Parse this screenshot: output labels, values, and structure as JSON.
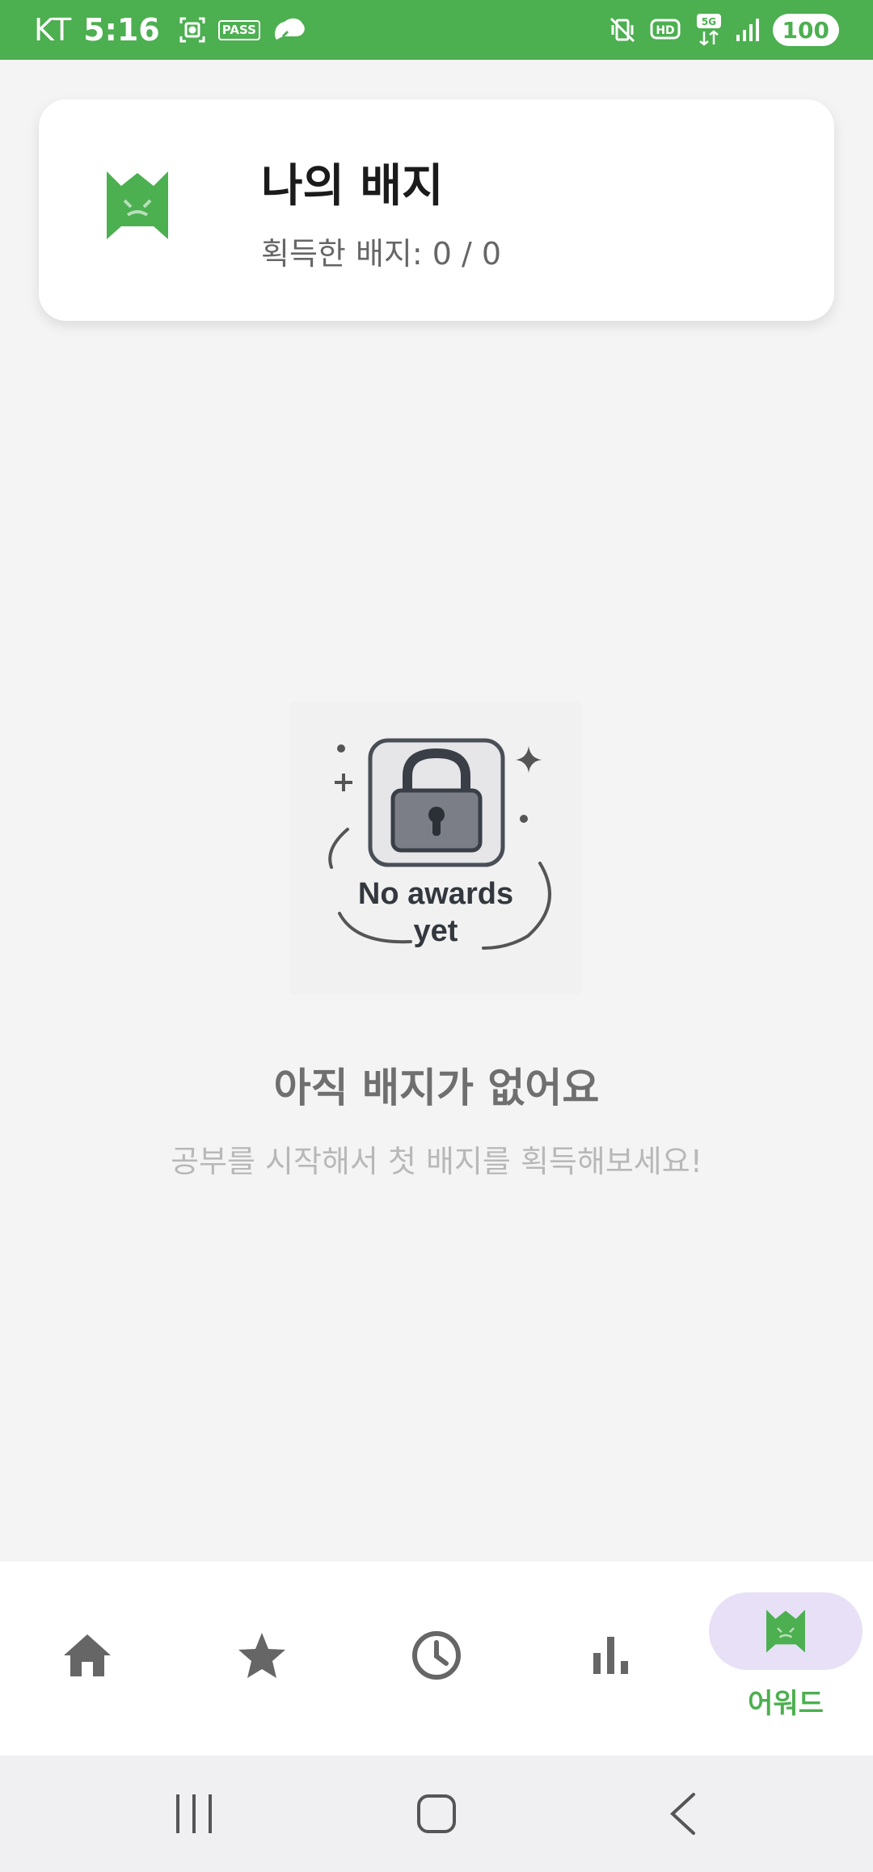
{
  "status_bar": {
    "carrier": "KT",
    "time": "5:16",
    "pass_label": "PASS",
    "hd_label": "HD",
    "network_label": "5G",
    "battery": "100"
  },
  "badge_card": {
    "title": "나의 배지",
    "subtitle": "획득한 배지: 0 / 0"
  },
  "empty_state": {
    "illustration_text_line1": "No awards",
    "illustration_text_line2": "yet",
    "title": "아직 배지가 없어요",
    "subtitle": "공부를 시작해서 첫 배지를 획득해보세요!"
  },
  "bottom_nav": {
    "items": [
      {
        "icon": "home-icon",
        "label": ""
      },
      {
        "icon": "star-icon",
        "label": ""
      },
      {
        "icon": "clock-icon",
        "label": ""
      },
      {
        "icon": "bar-chart-icon",
        "label": ""
      },
      {
        "icon": "award-icon",
        "label": "어워드",
        "active": true
      }
    ]
  },
  "colors": {
    "accent": "#4caf50",
    "active_pill": "#e8e0f7",
    "icon_gray": "#666666"
  }
}
